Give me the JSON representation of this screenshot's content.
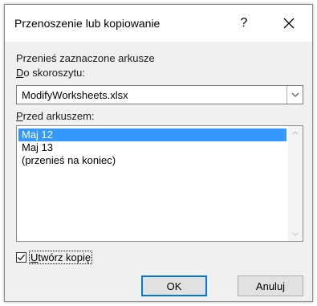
{
  "dialog": {
    "title": "Przenoszenie lub kopiowanie",
    "help_label": "?",
    "close_icon": "close-icon"
  },
  "move_label": "Przenieś zaznaczone arkusze",
  "to_book": {
    "label": "Do skoroszytu:",
    "selected": "ModifyWorksheets.xlsx"
  },
  "before_sheet": {
    "label": "Przed arkuszem:",
    "items": [
      "Maj 12",
      "Maj 13",
      "(przenieś na koniec)"
    ],
    "selected_index": 0
  },
  "create_copy": {
    "label": "Utwórz kopię",
    "checked": true
  },
  "buttons": {
    "ok": "OK",
    "cancel": "Anuluj"
  },
  "colors": {
    "selection": "#3399ff",
    "focus_border": "#0078d7"
  }
}
